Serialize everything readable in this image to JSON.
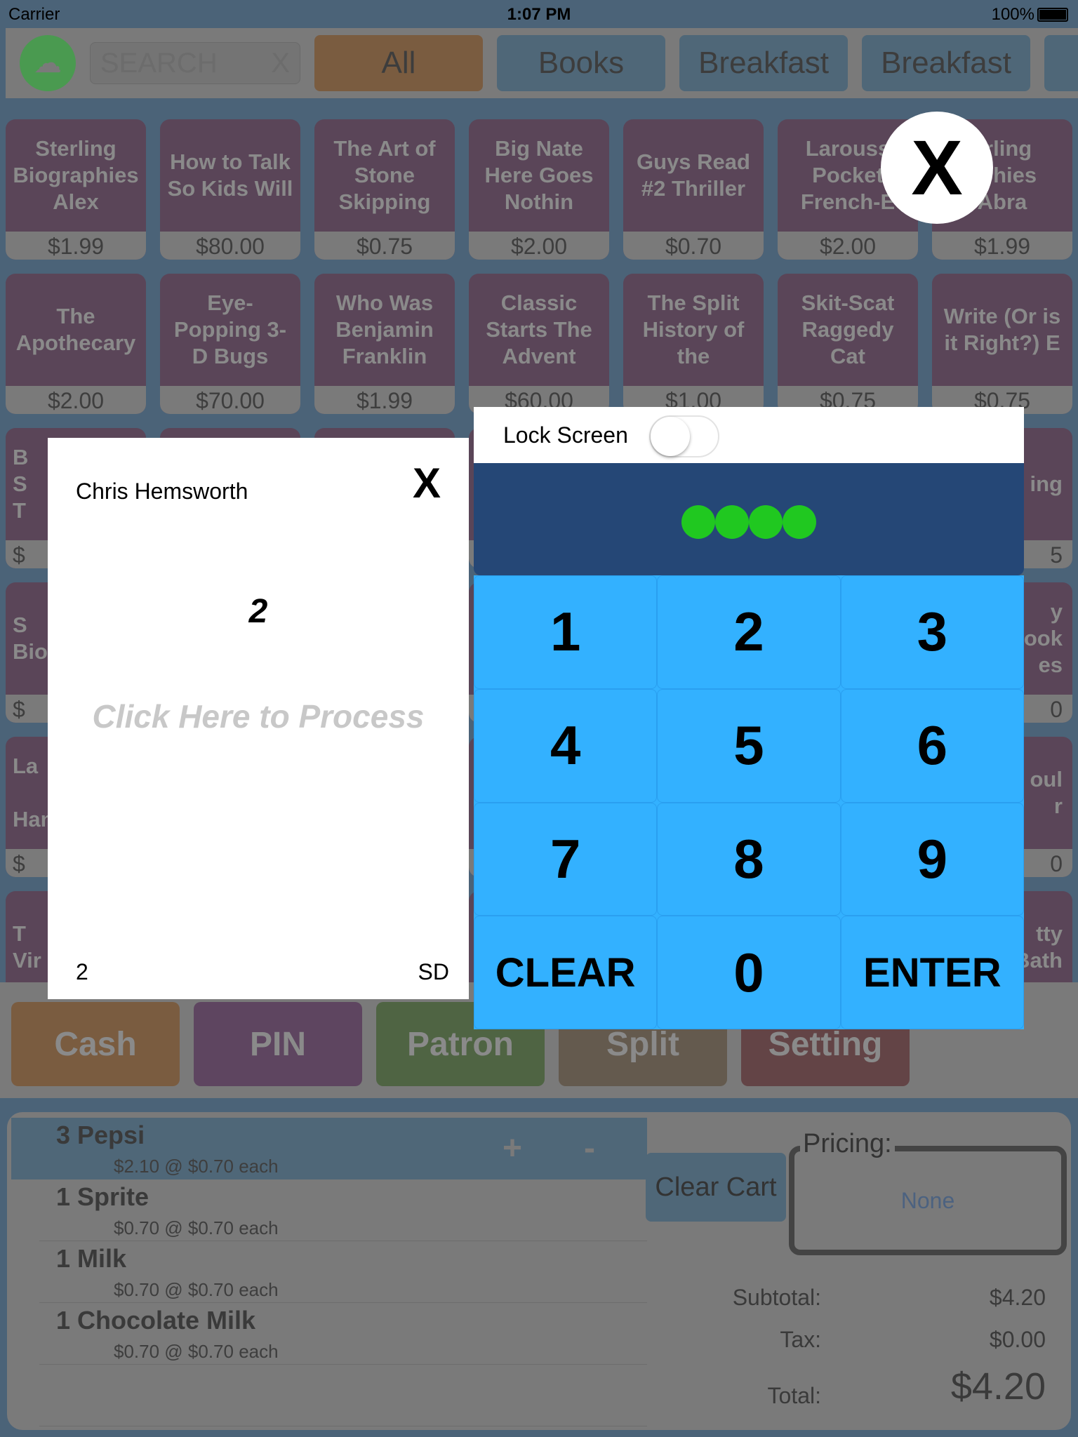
{
  "status": {
    "carrier": "Carrier",
    "time": "1:07 PM",
    "battery": "100%"
  },
  "header": {
    "search_placeholder": "SEARCH",
    "search_clear": "X",
    "tabs": [
      "All",
      "Books",
      "Breakfast",
      "Breakfast"
    ]
  },
  "products": [
    [
      {
        "name": "Sterling\nBiographies\nAlex",
        "price": "$1.99"
      },
      {
        "name": "How to Talk\nSo Kids Will",
        "price": "$80.00"
      },
      {
        "name": "The Art of\nStone\nSkipping",
        "price": "$0.75"
      },
      {
        "name": "Big Nate\nHere Goes\nNothin",
        "price": "$2.00"
      },
      {
        "name": "Guys Read\n#2  Thriller",
        "price": "$0.70"
      },
      {
        "name": "Larouss\nPocket\nFrench-E",
        "price": "$2.00"
      },
      {
        "name": "erling\naphies\nAbra",
        "price": "$1.99"
      }
    ],
    [
      {
        "name": "The\nApothecary",
        "price": "$2.00"
      },
      {
        "name": "Eye-\nPopping 3-\nD Bugs",
        "price": "$70.00"
      },
      {
        "name": "Who Was\nBenjamin\nFranklin",
        "price": "$1.99"
      },
      {
        "name": "Classic\nStarts The\nAdvent",
        "price": "$60.00"
      },
      {
        "name": "The Split\nHistory of\nthe",
        "price": "$1.00"
      },
      {
        "name": "Skit-Scat\nRaggedy\nCat",
        "price": "$0.75"
      },
      {
        "name": "Write (Or is\nit Right?) E",
        "price": "$0.75"
      }
    ],
    [
      {
        "name": "B\nS\nT",
        "price": "$"
      },
      {
        "name": "ing",
        "price": "5"
      }
    ],
    [
      {
        "name": "S\nBio",
        "price": "$"
      },
      {
        "name": "y\nook\nes",
        "price": "0"
      }
    ],
    [
      {
        "name": "La\n\nHan",
        "price": "$"
      },
      {
        "name": "oul\nr",
        "price": "0"
      }
    ],
    [
      {
        "name": "T\nVir",
        "price": ""
      },
      {
        "name": "tty\nBath",
        "price": ""
      }
    ]
  ],
  "actions": [
    "Cash",
    "PIN",
    "Patron",
    "Split",
    "Setting"
  ],
  "cart": {
    "items": [
      {
        "title": "3 Pepsi",
        "sub": "$2.10 @ $0.70 each",
        "selected": true
      },
      {
        "title": "1 Sprite",
        "sub": "$0.70 @ $0.70 each"
      },
      {
        "title": "1 Milk",
        "sub": "$0.70 @ $0.70 each"
      },
      {
        "title": "1 Chocolate Milk",
        "sub": "$0.70 @ $0.70 each"
      }
    ],
    "plus": "+",
    "minus": "-",
    "clear_label": "Clear Cart",
    "pricing_label": "Pricing:",
    "pricing_value": "None",
    "subtotal_label": "Subtotal:",
    "subtotal": "$4.20",
    "tax_label": "Tax:",
    "tax": "$0.00",
    "total_label": "Total:",
    "total": "$4.20"
  },
  "close_overlay": "X",
  "customer_card": {
    "name": "Chris  Hemsworth",
    "close": "X",
    "number": "2",
    "process": "Click Here to Process",
    "bottom_left": "2",
    "bottom_right": "SD"
  },
  "lock": {
    "label": "Lock Screen",
    "toggle_on": false,
    "pin_dots": 4,
    "pin_dot_color": "#20c820"
  },
  "keypad": [
    "1",
    "2",
    "3",
    "4",
    "5",
    "6",
    "7",
    "8",
    "9",
    "CLEAR",
    "0",
    "ENTER"
  ]
}
